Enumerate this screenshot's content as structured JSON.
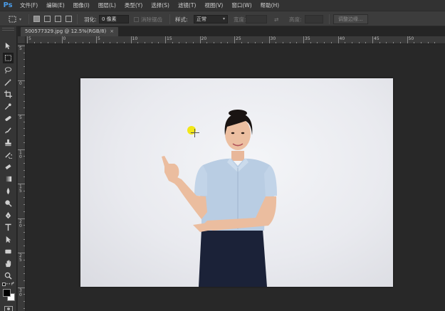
{
  "app": {
    "logo": "Ps"
  },
  "menu": [
    "文件(F)",
    "编辑(E)",
    "图像(I)",
    "图层(L)",
    "类型(Y)",
    "选择(S)",
    "滤镜(T)",
    "视图(V)",
    "窗口(W)",
    "帮助(H)"
  ],
  "options": {
    "feather_label": "羽化:",
    "feather_value": "0 像素",
    "antialias_label": "消除锯齿",
    "style_label": "样式:",
    "style_value": "正常",
    "width_label": "宽度:",
    "height_label": "高度:",
    "refine_edge_label": "调整边缘..."
  },
  "document": {
    "tab_title": "500577329.jpg @ 12.5%(RGB/8)",
    "close_glyph": "×"
  },
  "ruler": {
    "h_labels": [
      "5",
      "0",
      "5",
      "10",
      "15",
      "20",
      "25",
      "30",
      "35",
      "40",
      "45",
      "50"
    ],
    "v_labels": [
      "5",
      "0",
      "5",
      "1 0",
      "1 5",
      "2 0",
      "2 5",
      "3 0"
    ]
  },
  "icons": {
    "tools": [
      "move-icon",
      "marquee-icon",
      "lasso-icon",
      "magic-wand-icon",
      "crop-icon",
      "eyedropper-icon",
      "healing-brush-icon",
      "brush-icon",
      "clone-stamp-icon",
      "history-brush-icon",
      "eraser-icon",
      "gradient-icon",
      "blur-icon",
      "dodge-icon",
      "pen-icon",
      "type-icon",
      "path-selection-icon",
      "shape-icon",
      "hand-icon",
      "zoom-icon"
    ]
  },
  "colors": {
    "foreground": "#000000",
    "background": "#ffffff",
    "accent_logo": "#4a9be6",
    "cursor_highlight": "#f2e600"
  }
}
